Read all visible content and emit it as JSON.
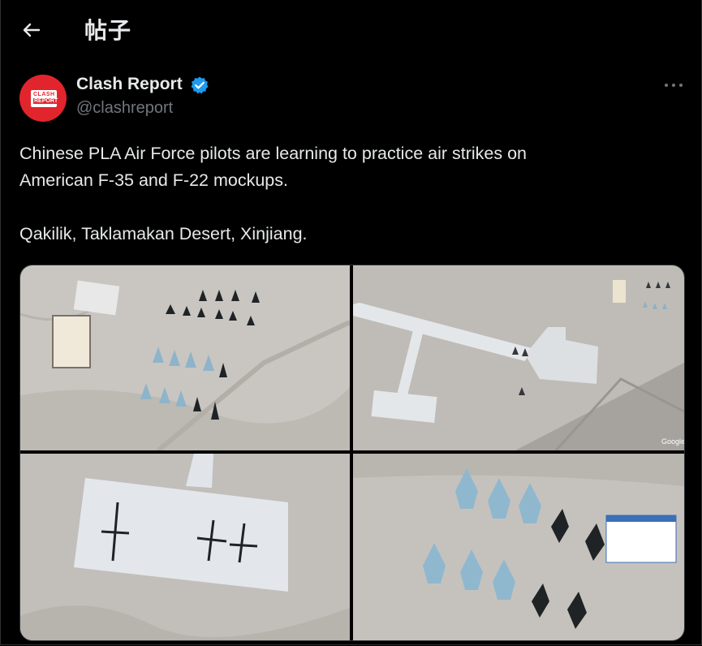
{
  "header": {
    "title": "帖子",
    "back_icon": "arrow-left-icon"
  },
  "post": {
    "author_name": "Clash Report",
    "author_handle": "@clashreport",
    "verified": true,
    "avatar": {
      "logo_text_1": "CLASH",
      "logo_text_2": "REPORT",
      "color": "#e2252d"
    },
    "text_lines": [
      "Chinese PLA Air Force pilots are learning to practice air strikes on",
      "American F-35 and F-22 mockups.",
      "Qakilik, Taklamakan Desert, Xinjiang."
    ]
  },
  "media": {
    "images": [
      {
        "scene": "desert-airfield-aircraft-rows"
      },
      {
        "scene": "desert-runway-taxiway"
      },
      {
        "scene": "concrete-apron-aircraft-mockups"
      },
      {
        "scene": "stealth-fighter-mockups-closeup"
      }
    ],
    "watermark": "Google"
  },
  "colors": {
    "background": "#000000",
    "text": "#e7e9ea",
    "muted": "#71767b",
    "verified": "#1d9bf0"
  }
}
